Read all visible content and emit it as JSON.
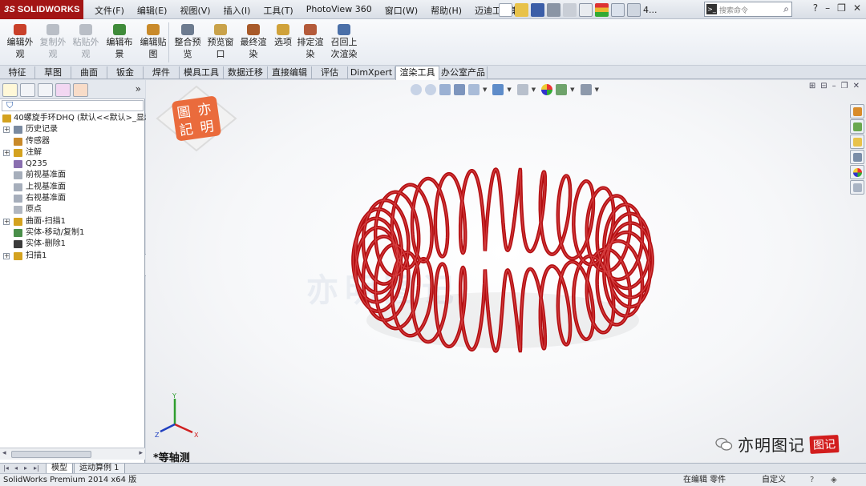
{
  "app": {
    "logo_prefix": "3S",
    "logo_text": "SOLIDWORKS"
  },
  "menu": [
    "文件(F)",
    "编辑(E)",
    "视图(V)",
    "插入(I)",
    "工具(T)",
    "PhotoView 360",
    "窗口(W)",
    "帮助(H)",
    "迈迪工具集"
  ],
  "search": {
    "prefix": ">_",
    "placeholder": "搜索命令"
  },
  "quick_counter": "4...",
  "ribbon": [
    {
      "label": "编辑外\n观",
      "disabled": false,
      "color": "#c9402a"
    },
    {
      "label": "复制外\n观",
      "disabled": true,
      "color": "#b9bec6"
    },
    {
      "label": "粘贴外\n观",
      "disabled": true,
      "color": "#b9bec6"
    },
    {
      "label": "编辑布\n景",
      "disabled": false,
      "color": "#3f8b3a"
    },
    {
      "label": "编辑贴\n图",
      "disabled": false,
      "color": "#c98a2a"
    },
    {
      "label": "整合预\n览",
      "disabled": false,
      "color": "#6d7b8f"
    },
    {
      "label": "预览窗\n口",
      "disabled": false,
      "color": "#c9a24a"
    },
    {
      "label": "最终渲\n染",
      "disabled": false,
      "color": "#a85a2a"
    },
    {
      "label": "选项",
      "disabled": false,
      "color": "#d0a23a"
    },
    {
      "label": "排定渲\n染",
      "disabled": false,
      "color": "#b45a3a"
    },
    {
      "label": "召回上\n次渲染",
      "disabled": false,
      "color": "#4a6fa8"
    }
  ],
  "tabs": [
    "特征",
    "草图",
    "曲面",
    "钣金",
    "焊件",
    "模具工具",
    "数据迁移",
    "直接编辑",
    "评估",
    "DimXpert",
    "渲染工具",
    "办公室产品"
  ],
  "active_tab": "渲染工具",
  "tree": [
    {
      "label": "40螺旋手环DHQ  (默认<<默认>_显示",
      "root": true,
      "expand": "",
      "icon": "#d4a21f"
    },
    {
      "label": "历史记录",
      "expand": "+",
      "icon": "#7a8aa0"
    },
    {
      "label": "传感器",
      "expand": "",
      "icon": "#c98a2a"
    },
    {
      "label": "注解",
      "expand": "+",
      "icon": "#d4a21f"
    },
    {
      "label": "Q235",
      "expand": "",
      "icon": "#8a6fb0"
    },
    {
      "label": "前视基准面",
      "expand": "",
      "icon": "#a6aebb"
    },
    {
      "label": "上视基准面",
      "expand": "",
      "icon": "#a6aebb"
    },
    {
      "label": "右视基准面",
      "expand": "",
      "icon": "#a6aebb"
    },
    {
      "label": "原点",
      "expand": "",
      "icon": "#b0b6c0"
    },
    {
      "label": "曲面-扫描1",
      "expand": "+",
      "icon": "#d4a21f"
    },
    {
      "label": "实体-移动/复制1",
      "expand": "",
      "icon": "#4a8f4a"
    },
    {
      "label": "实体-删除1",
      "expand": "",
      "icon": "#3b3b3b"
    },
    {
      "label": "扫描1",
      "expand": "+",
      "icon": "#d4a21f"
    }
  ],
  "bottom_tabs": [
    "模型",
    "运动算例 1"
  ],
  "status": {
    "left": "SolidWorks Premium 2014 x64 版",
    "editing": "在编辑 零件",
    "units": "自定义",
    "help": "?"
  },
  "viewport": {
    "view_name": "*等轴测",
    "stamp_text": [
      "圖",
      "亦",
      "記",
      "明"
    ],
    "watermark": "亦明图记",
    "brand_text": "亦明图记",
    "brand_badge": "图记",
    "triad": {
      "x": "X",
      "y": "Y",
      "z": "Z"
    },
    "coil_color": "#b30f12"
  }
}
